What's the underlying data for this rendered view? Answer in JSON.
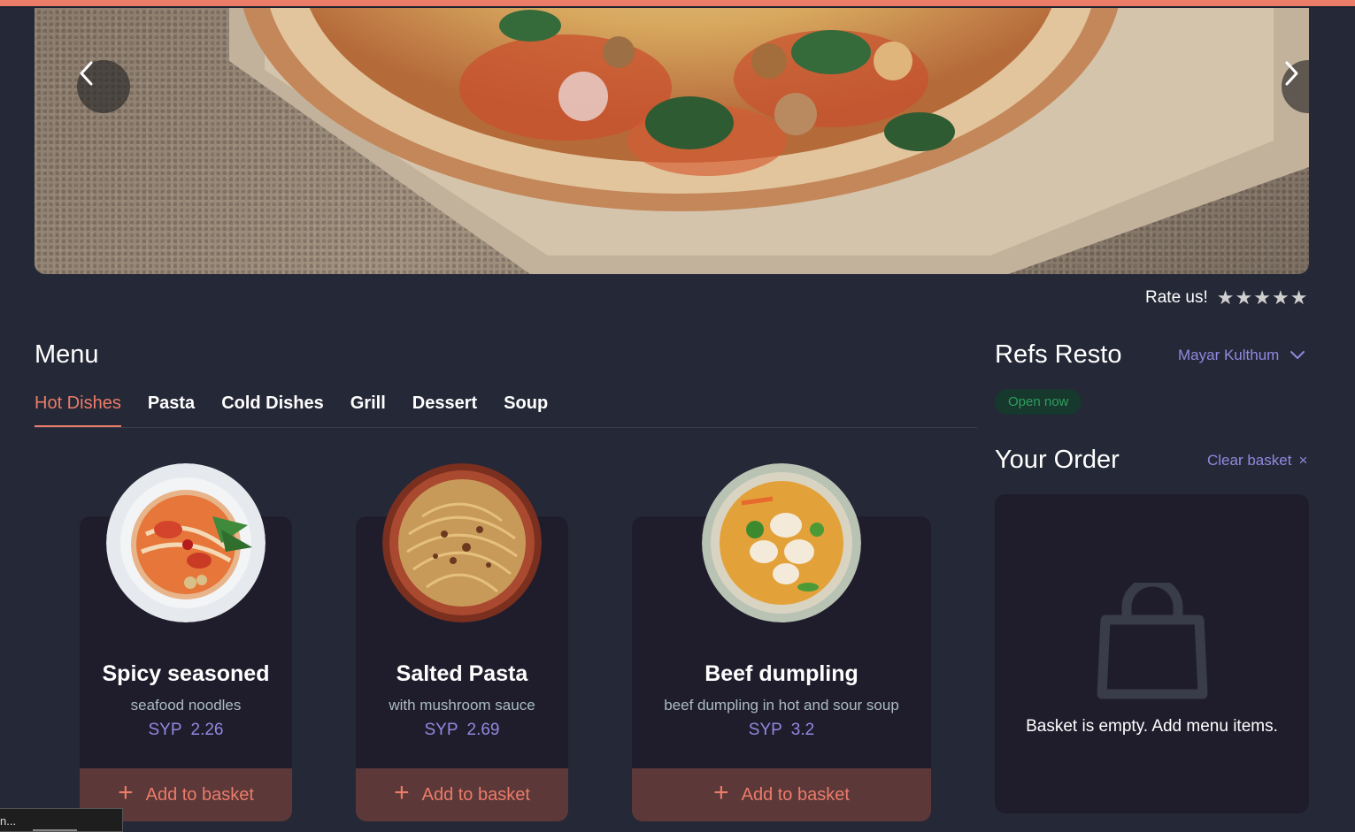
{
  "hero": {
    "prev_icon": "chevron-left-icon",
    "next_icon": "chevron-right-icon"
  },
  "rating": {
    "label": "Rate us!",
    "stars": [
      "★",
      "★",
      "★",
      "★",
      "★"
    ],
    "value": 0,
    "max": 5
  },
  "menu": {
    "title": "Menu",
    "tabs": [
      {
        "label": "Hot Dishes",
        "active": true
      },
      {
        "label": "Pasta",
        "active": false
      },
      {
        "label": "Cold Dishes",
        "active": false
      },
      {
        "label": "Grill",
        "active": false
      },
      {
        "label": "Dessert",
        "active": false
      },
      {
        "label": "Soup",
        "active": false
      }
    ],
    "items": [
      {
        "name": "Spicy seasoned",
        "description": "seafood noodles",
        "currency": "SYP",
        "price": "2.26",
        "button": "Add to basket"
      },
      {
        "name": "Salted Pasta",
        "description": "with mushroom sauce",
        "currency": "SYP",
        "price": "2.69",
        "button": "Add to basket"
      },
      {
        "name": "Beef dumpling",
        "description": "beef dumpling in hot and sour soup",
        "currency": "SYP",
        "price": "3.2",
        "button": "Add to basket"
      }
    ]
  },
  "restaurant": {
    "name": "Refs Resto",
    "user": "Mayar Kulthum",
    "status": "Open now"
  },
  "order": {
    "title": "Your Order",
    "clear_label": "Clear basket",
    "clear_icon": "×",
    "empty_message": "Basket is empty. Add menu items."
  },
  "status_tip": "n...",
  "colors": {
    "accent": "#EA7C69",
    "background": "#252836",
    "card": "#1F1D2B",
    "price": "#9288E0",
    "open": "#2E9E5E"
  }
}
